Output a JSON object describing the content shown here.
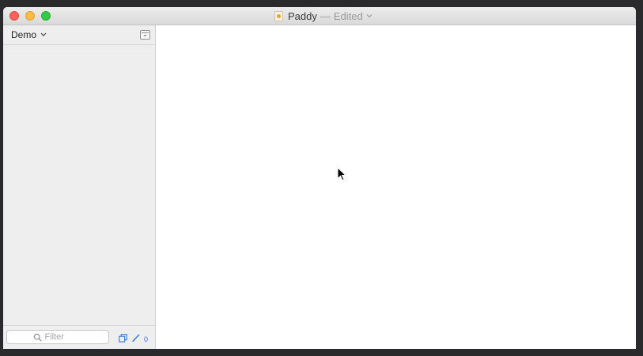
{
  "window": {
    "title": "Paddy",
    "title_separator": "—",
    "title_status": "Edited"
  },
  "sidebar": {
    "project_label": "Demo",
    "filter_placeholder": "Filter",
    "filter_value": "",
    "badge_count": "0"
  },
  "icons": {
    "close": "close-dot",
    "minimize": "minimize-dot",
    "zoom": "zoom-dot",
    "document": "document-icon",
    "search": "search-icon",
    "collapse": "collapse-sidebar-icon",
    "copy": "copy-icon",
    "brush": "brush-icon"
  },
  "colors": {
    "accent": "#3478d6",
    "close": "#fc605c",
    "minimize": "#fdbc40",
    "zoom": "#34c84a"
  }
}
